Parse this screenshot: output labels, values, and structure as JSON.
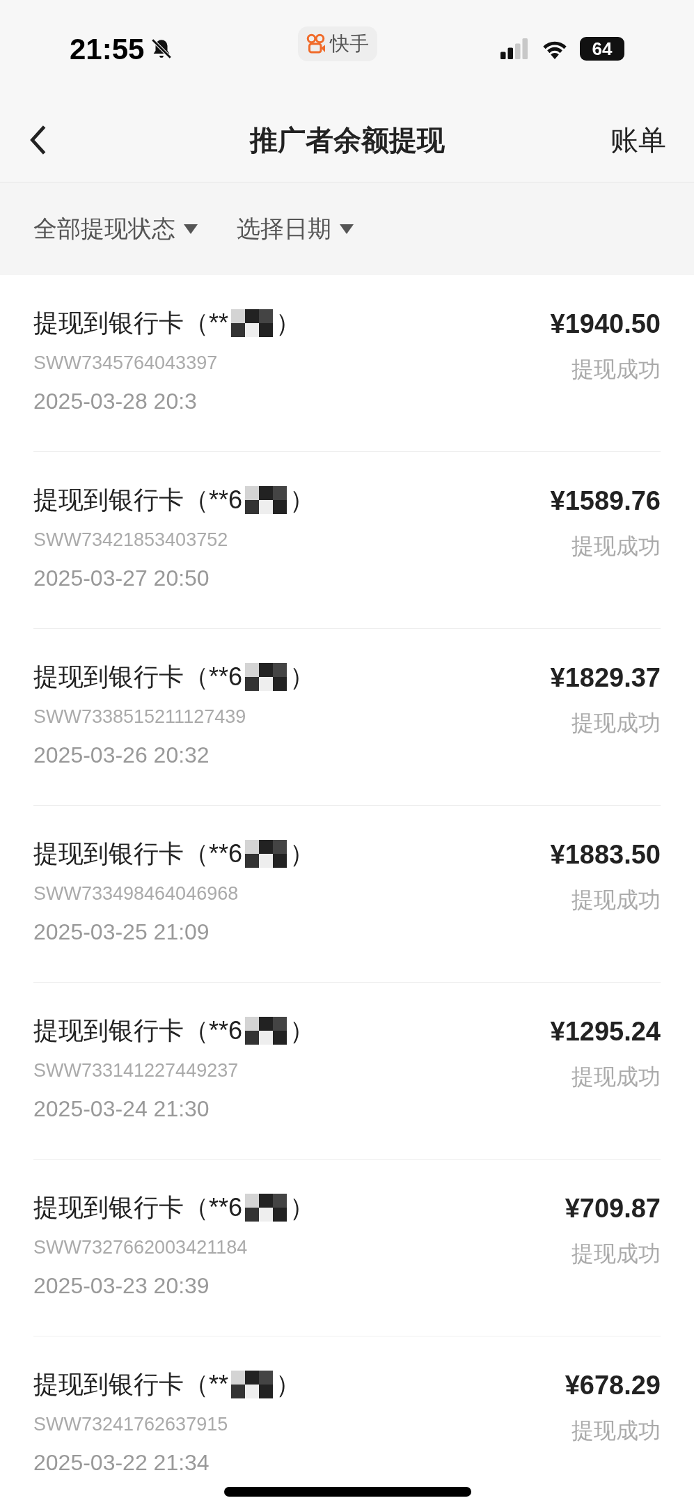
{
  "status_bar": {
    "time": "21:55",
    "app_pill": "快手",
    "battery": "64"
  },
  "nav": {
    "title": "推广者余额提现",
    "action": "账单"
  },
  "filters": [
    {
      "label": "全部提现状态"
    },
    {
      "label": "选择日期"
    }
  ],
  "records": [
    {
      "title": "提现到银行卡（**",
      "suffix": "）",
      "serial": "SWW7345764043397",
      "time": "2025-03-28 20:3",
      "amount": "¥1940.50",
      "status": "提现成功"
    },
    {
      "title": "提现到银行卡（**6",
      "suffix": "）",
      "serial": "SWW73421853403752",
      "time": "2025-03-27 20:50",
      "amount": "¥1589.76",
      "status": "提现成功"
    },
    {
      "title": "提现到银行卡（**6",
      "suffix": "）",
      "serial": "SWW7338515211127439",
      "time": "2025-03-26 20:32",
      "amount": "¥1829.37",
      "status": "提现成功"
    },
    {
      "title": "提现到银行卡（**6",
      "suffix": "）",
      "serial": "SWW733498464046968",
      "time": "2025-03-25 21:09",
      "amount": "¥1883.50",
      "status": "提现成功"
    },
    {
      "title": "提现到银行卡（**6",
      "suffix": "）",
      "serial": "SWW733141227449237",
      "time": "2025-03-24 21:30",
      "amount": "¥1295.24",
      "status": "提现成功"
    },
    {
      "title": "提现到银行卡（**6",
      "suffix": "）",
      "serial": "SWW7327662003421184",
      "time": "2025-03-23 20:39",
      "amount": "¥709.87",
      "status": "提现成功"
    },
    {
      "title": "提现到银行卡（**",
      "suffix": "）",
      "serial": "SWW73241762637915",
      "time": "2025-03-22 21:34",
      "amount": "¥678.29",
      "status": "提现成功"
    }
  ]
}
